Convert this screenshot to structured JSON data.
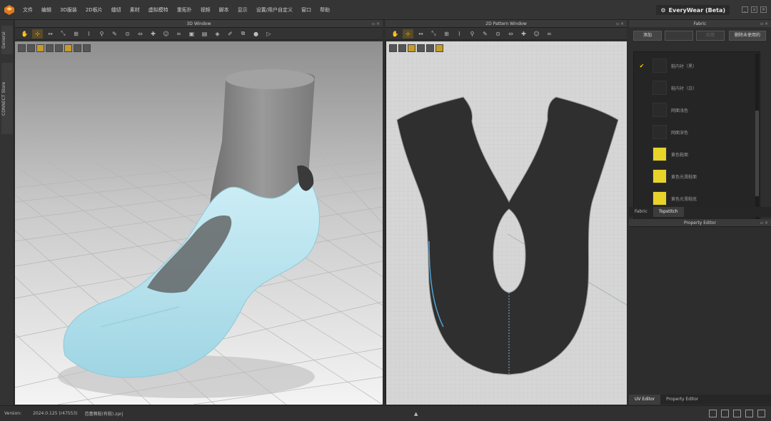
{
  "menubar": {
    "items": [
      "文件",
      "编辑",
      "3D服装",
      "2D板片",
      "缝纫",
      "素材",
      "虚拟模特",
      "重拓扑",
      "视频",
      "脚本",
      "显示",
      "设置/用户自定义",
      "窗口",
      "帮助"
    ],
    "app_title": "EveryWear (Beta)",
    "window_buttons": [
      "_",
      "▫",
      "×"
    ]
  },
  "left_strip": {
    "tabs": [
      "General",
      "CONNECT Store"
    ]
  },
  "window_3d": {
    "title": "3D Window",
    "header_icons": "▫ ×",
    "toolbar_icon_names": [
      "hand-icon",
      "select-icon",
      "move-icon",
      "transform-icon",
      "arrange-icon",
      "fold-icon",
      "pin-icon",
      "brush-icon",
      "tack-icon",
      "measure-icon",
      "sew-icon",
      "avatar-icon",
      "strap-icon",
      "fabric-icon",
      "texture-icon",
      "graphic-icon",
      "edit-icon",
      "clone-icon",
      "record-icon",
      "anim-icon"
    ],
    "subtool_icon_names": [
      "subtool-a-icon",
      "subtool-b-icon",
      "subtool-c-icon",
      "subtool-d-icon",
      "subtool-e-icon",
      "subtool-f-icon",
      "subtool-g-icon",
      "subtool-h-icon"
    ]
  },
  "window_2d": {
    "title": "2D Pattern Window",
    "header_icons": "▫ ×",
    "toolbar_icon_names": [
      "select-point-icon",
      "transform-pattern-icon",
      "edit-pattern-icon",
      "polygon-icon",
      "rectangle-icon",
      "circle-icon",
      "internal-line-icon",
      "dart-icon",
      "notch-icon",
      "sewing-icon",
      "seam-icon",
      "trim-icon",
      "shirt-icon"
    ],
    "subtool_icon_names": [
      "subtool-a-icon",
      "subtool-b-icon",
      "subtool-c-icon",
      "subtool-d-icon",
      "subtool-e-icon",
      "subtool-f-icon"
    ]
  },
  "fabric_panel": {
    "title": "Fabric",
    "header_icons": "▫ ×",
    "buttons": {
      "add": "添加",
      "b2": "",
      "b3": "应用",
      "delete_unused": "删除未使用的"
    },
    "items": [
      {
        "name": "鞋内衬（黑）",
        "color": "#2a2a2a",
        "checked": true
      },
      {
        "name": "鞋内衬（白）",
        "color": "#2a2a2a",
        "checked": false
      },
      {
        "name": "网面浅色",
        "color": "#2a2a2a",
        "checked": false
      },
      {
        "name": "网面深色",
        "color": "#2a2a2a",
        "checked": false
      },
      {
        "name": "黄色鞋面",
        "color": "#e8d429",
        "checked": false
      },
      {
        "name": "黄色光滑鞋面",
        "color": "#e8d429",
        "checked": false
      },
      {
        "name": "黄色光滑鞋底",
        "color": "#e8d429",
        "checked": false
      }
    ],
    "tabs": [
      "Fabric",
      "Topstitch"
    ]
  },
  "property_panel": {
    "title": "Property Editor",
    "header_icons": "▫ ×",
    "tabs": [
      "UV Editor",
      "Property Editor"
    ]
  },
  "statusbar": {
    "version_label": "Version:",
    "version_value": "2024.0.125 (r47553)",
    "file_name": "芭蕾舞鞋(有鞋).zprj"
  },
  "colors": {
    "shoe": "#b3e3ef",
    "foot": "#8e8e8e",
    "pattern": "#2f2f2f",
    "accent": "#ffcc33"
  }
}
